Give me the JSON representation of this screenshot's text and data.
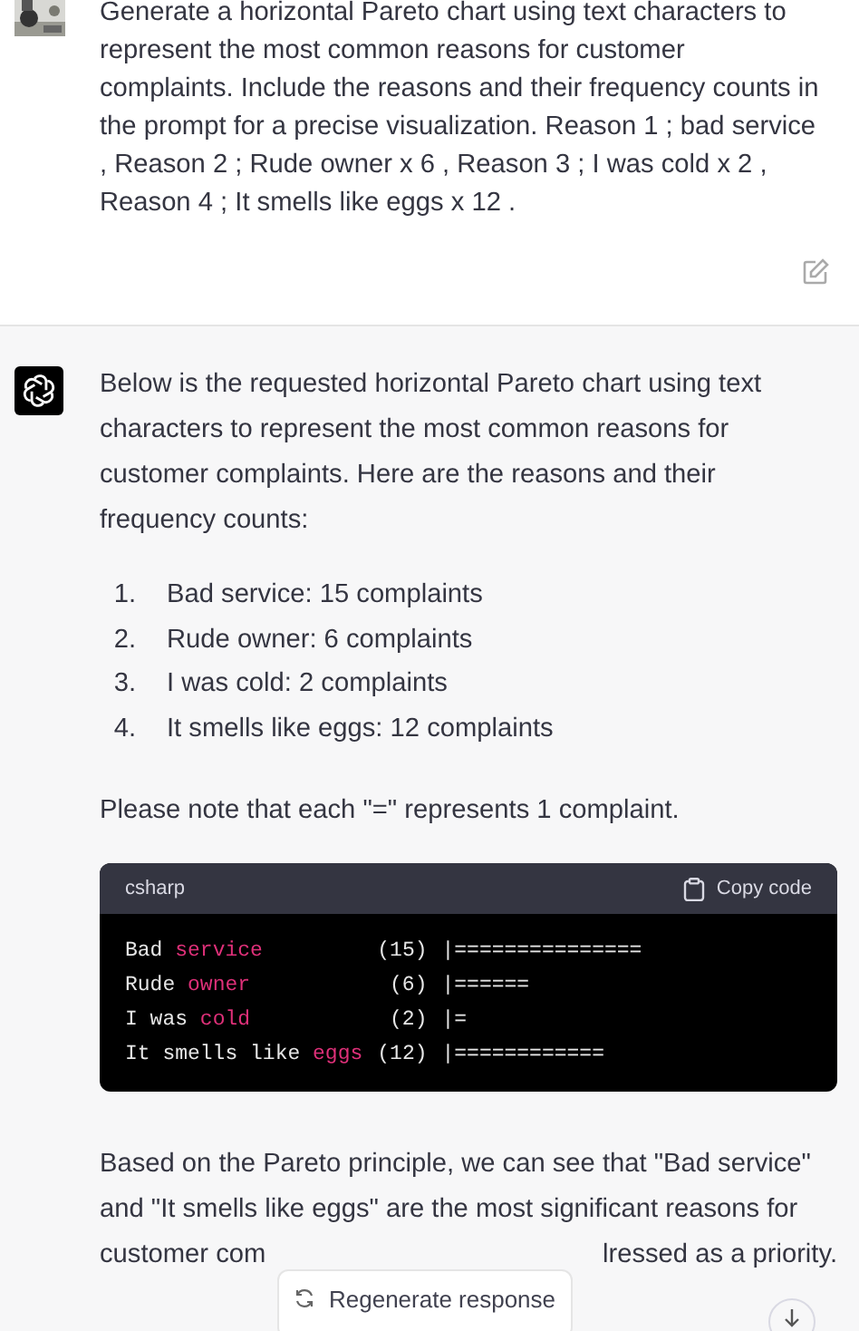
{
  "user_message": {
    "text": "Generate a horizontal Pareto chart using text characters to represent the most common reasons for customer complaints. Include the reasons and their frequency counts in the prompt for a precise visualization. Reason 1 ; bad service , Reason 2 ; Rude owner x 6 , Reason 3 ; I was cold x 2 , Reason 4 ; It smells like eggs x 12 ."
  },
  "assistant_message": {
    "intro": "Below is the requested horizontal Pareto chart using text characters to represent the most common reasons for customer complaints. Here are the reasons and their frequency counts:",
    "list": [
      {
        "number": "1.",
        "text": "Bad service: 15 complaints"
      },
      {
        "number": "2.",
        "text": "Rude owner: 6 complaints"
      },
      {
        "number": "3.",
        "text": "I was cold: 2 complaints"
      },
      {
        "number": "4.",
        "text": "It smells like eggs: 12 complaints"
      }
    ],
    "note": "Please note that each \"=\" represents 1 complaint.",
    "code_block": {
      "language": "csharp",
      "copy_label": "Copy code",
      "lines": [
        {
          "parts": [
            {
              "text": "Bad ",
              "kind": "plain"
            },
            {
              "text": "service",
              "kind": "keyword"
            }
          ],
          "count": "(15)",
          "bar": "|==============="
        },
        {
          "parts": [
            {
              "text": "Rude ",
              "kind": "plain"
            },
            {
              "text": "owner",
              "kind": "keyword"
            }
          ],
          "count": "(6)",
          "bar": "|======"
        },
        {
          "parts": [
            {
              "text": "I was ",
              "kind": "plain"
            },
            {
              "text": "cold",
              "kind": "keyword"
            }
          ],
          "count": "(2)",
          "bar": "|="
        },
        {
          "parts": [
            {
              "text": "It smells like ",
              "kind": "plain"
            },
            {
              "text": "eggs",
              "kind": "keyword"
            }
          ],
          "count": "(12)",
          "bar": "|============"
        }
      ]
    },
    "conclusion": "Based on the Pareto principle, we can see that \"Bad service\" and \"It smells like eggs\" are the most significant reasons for",
    "conclusion_tail": [
      "customer com",
      "lressed as a priority."
    ]
  },
  "regenerate_button": {
    "label": "Regenerate response"
  }
}
